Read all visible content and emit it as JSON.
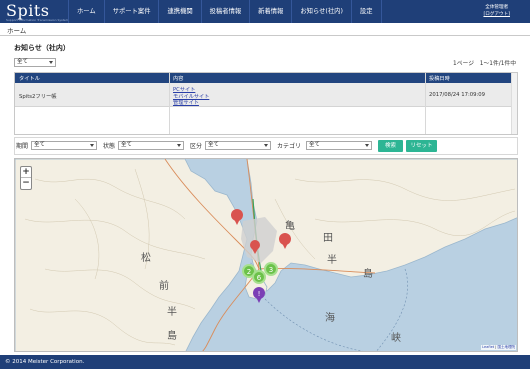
{
  "header": {
    "logo": "Spits",
    "logo_sub": "Support Information Transmission System",
    "nav": [
      "ホーム",
      "サポート案件",
      "連携機関",
      "投稿者情報",
      "新着情報",
      "お知らせ(社内)",
      "設定"
    ],
    "user_label": "全体管理者",
    "logout": "[ログアウト]"
  },
  "breadcrumb": "ホーム",
  "page_title": "お知らせ（社内）",
  "top_filter": "全て",
  "pager": "1ページ　1～1件/1件中",
  "table": {
    "columns": [
      "タイトル",
      "内容",
      "投稿日時"
    ],
    "rows": [
      {
        "title": "Spits2フリー帳",
        "links": [
          "PCサイト",
          "モバイルサイト",
          "管理サイト"
        ],
        "date": "2017/08/24 17:09:09"
      }
    ]
  },
  "filters": {
    "period_label": "期間",
    "period_value": "全て",
    "state_label": "状態",
    "state_value": "全て",
    "category1_label": "区分",
    "category1_value": "全て",
    "category2_label": "カテゴリ",
    "category2_value": "全て",
    "search": "検索",
    "reset": "リセット"
  },
  "map": {
    "zoom_in": "+",
    "zoom_out": "−",
    "attribution_leaflet": "Leaflet",
    "attribution_sep": " | ",
    "attribution_gsi": "国土地理院",
    "place_labels": [
      "松",
      "前",
      "半",
      "島",
      "亀",
      "田",
      "半",
      "島",
      "海",
      "峡"
    ],
    "cluster_counts": [
      "2",
      "6",
      "3"
    ],
    "colors": {
      "sea": "#b9d0e2",
      "land": "#f3efe3",
      "cluster": "#6cc24a",
      "pin_red": "#d9534f",
      "pin_purple": "#7b3fb5"
    }
  },
  "footer": "© 2014 Meister Corporation."
}
